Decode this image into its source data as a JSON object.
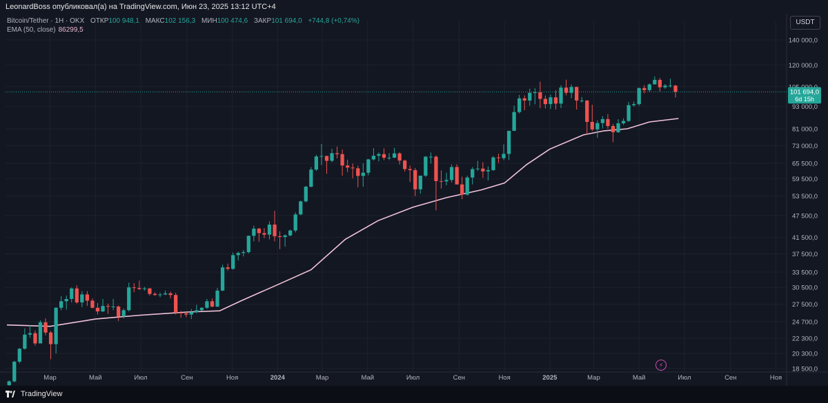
{
  "header": {
    "publish_line": "LeonardBoss опубликовал(а) на TradingView.com, Июн 23, 2025 13:12 UTC+4"
  },
  "legend": {
    "symbol": "Bitcoin/Tether · 1H · OKX",
    "open_label": "ОТКР",
    "open_value": "100 948,1",
    "high_label": "МАКС",
    "high_value": "102 156,3",
    "low_label": "МИН",
    "low_value": "100 474,6",
    "close_label": "ЗАКР",
    "close_value": "101 694,0",
    "change": "+744,8 (+0,74%)",
    "ema_label": "EMA (50, close)",
    "ema_value": "86299,5"
  },
  "currency_button": "USDT",
  "price_tag": {
    "price": "101 694,0",
    "countdown": "6d 15h"
  },
  "footer": {
    "brand": "TradingView"
  },
  "colors": {
    "up": "#26a69a",
    "down": "#ef5350",
    "ema": "#f2c4d9",
    "background": "#131722"
  },
  "chart_data": {
    "type": "candlestick",
    "title": "",
    "scale": "logarithmic",
    "last_price": 101694.0,
    "y_ticks": [
      {
        "value": 18500,
        "label": "18 500,0"
      },
      {
        "value": 20300,
        "label": "20 300,0"
      },
      {
        "value": 22300,
        "label": "22 300,0"
      },
      {
        "value": 24700,
        "label": "24 700,0"
      },
      {
        "value": 27500,
        "label": "27 500,0"
      },
      {
        "value": 30500,
        "label": "30 500,0"
      },
      {
        "value": 33500,
        "label": "33 500,0"
      },
      {
        "value": 37500,
        "label": "37 500,0"
      },
      {
        "value": 41500,
        "label": "41 500,0"
      },
      {
        "value": 47500,
        "label": "47 500,0"
      },
      {
        "value": 53500,
        "label": "53 500,0"
      },
      {
        "value": 59500,
        "label": "59 500,0"
      },
      {
        "value": 65500,
        "label": "65 500,0"
      },
      {
        "value": 73000,
        "label": "73 000,0"
      },
      {
        "value": 81000,
        "label": "81 000,0"
      },
      {
        "value": 93000,
        "label": "93 000,0"
      },
      {
        "value": 105000,
        "label": "105 000,0"
      },
      {
        "value": 120000,
        "label": "120 000,0"
      },
      {
        "value": 140000,
        "label": "140 000,0"
      }
    ],
    "x_ticks": [
      {
        "date": "2023-03-01",
        "label": "Мар"
      },
      {
        "date": "2023-05-01",
        "label": "Май"
      },
      {
        "date": "2023-07-01",
        "label": "Июл"
      },
      {
        "date": "2023-09-01",
        "label": "Сен"
      },
      {
        "date": "2023-11-01",
        "label": "Ноя"
      },
      {
        "date": "2024-01-01",
        "label": "2024"
      },
      {
        "date": "2024-03-01",
        "label": "Мар"
      },
      {
        "date": "2024-05-01",
        "label": "Май"
      },
      {
        "date": "2024-07-01",
        "label": "Июл"
      },
      {
        "date": "2024-09-01",
        "label": "Сен"
      },
      {
        "date": "2024-11-01",
        "label": "Ноя"
      },
      {
        "date": "2025-01-01",
        "label": "2025"
      },
      {
        "date": "2025-03-01",
        "label": "Мар"
      },
      {
        "date": "2025-05-01",
        "label": "Май"
      },
      {
        "date": "2025-07-01",
        "label": "Июл"
      },
      {
        "date": "2025-09-01",
        "label": "Сен"
      },
      {
        "date": "2025-11-01",
        "label": "Ноя"
      }
    ],
    "candle_start_date": "2023-01-02",
    "candle_interval_days": 7,
    "candles": [
      [
        16700,
        17200,
        16600,
        17100
      ],
      [
        17100,
        19400,
        17000,
        19300
      ],
      [
        19300,
        21000,
        19100,
        20900
      ],
      [
        20900,
        23700,
        20800,
        22800
      ],
      [
        22800,
        24200,
        22400,
        23000
      ],
      [
        23000,
        23400,
        21300,
        21600
      ],
      [
        21600,
        24900,
        21600,
        24600
      ],
      [
        24600,
        25200,
        22700,
        23100
      ],
      [
        23100,
        23300,
        19600,
        21500
      ],
      [
        21500,
        27000,
        20300,
        26900
      ],
      [
        26900,
        28900,
        26500,
        28000
      ],
      [
        28000,
        29000,
        26600,
        28400
      ],
      [
        28400,
        30500,
        27800,
        30300
      ],
      [
        30300,
        30900,
        27600,
        27800
      ],
      [
        27800,
        29800,
        27000,
        29200
      ],
      [
        29200,
        29800,
        27200,
        28100
      ],
      [
        28100,
        28500,
        26800,
        26900
      ],
      [
        26900,
        27700,
        25800,
        26300
      ],
      [
        26300,
        28400,
        26200,
        27200
      ],
      [
        27200,
        27600,
        25900,
        27100
      ],
      [
        27100,
        28400,
        26500,
        27100
      ],
      [
        27100,
        27300,
        24800,
        25500
      ],
      [
        25500,
        26800,
        25200,
        26500
      ],
      [
        26500,
        31400,
        26300,
        30500
      ],
      [
        30500,
        31300,
        29600,
        30400
      ],
      [
        30400,
        31800,
        30000,
        30200
      ],
      [
        30200,
        30600,
        29900,
        30300
      ],
      [
        30300,
        30400,
        29000,
        29300
      ],
      [
        29300,
        29600,
        29000,
        29100
      ],
      [
        29100,
        29500,
        28700,
        29200
      ],
      [
        29200,
        29900,
        29100,
        29400
      ],
      [
        29400,
        29700,
        28500,
        29100
      ],
      [
        29100,
        29500,
        25800,
        26100
      ],
      [
        26100,
        26400,
        25300,
        26000
      ],
      [
        26000,
        26200,
        25400,
        25800
      ],
      [
        25800,
        26700,
        25100,
        26200
      ],
      [
        26200,
        27400,
        26000,
        26500
      ],
      [
        26500,
        27000,
        26400,
        26900
      ],
      [
        26900,
        28400,
        26700,
        28000
      ],
      [
        28000,
        28500,
        27000,
        27100
      ],
      [
        27100,
        30400,
        27000,
        29900
      ],
      [
        29900,
        35100,
        29800,
        34500
      ],
      [
        34500,
        35300,
        33800,
        34200
      ],
      [
        34200,
        37800,
        34000,
        37200
      ],
      [
        37200,
        38000,
        36000,
        37700
      ],
      [
        37700,
        38400,
        36900,
        37900
      ],
      [
        37900,
        42000,
        37600,
        41900
      ],
      [
        41900,
        44600,
        40500,
        43800
      ],
      [
        43800,
        44000,
        40400,
        42600
      ],
      [
        42600,
        43900,
        41300,
        42200
      ],
      [
        42200,
        45800,
        41000,
        44900
      ],
      [
        44900,
        48900,
        40500,
        41800
      ],
      [
        41800,
        43100,
        38600,
        41600
      ],
      [
        41600,
        42300,
        39200,
        42000
      ],
      [
        42000,
        43500,
        41800,
        43300
      ],
      [
        43300,
        48400,
        42800,
        47800
      ],
      [
        47800,
        52100,
        47600,
        51800
      ],
      [
        51800,
        57000,
        51500,
        56700
      ],
      [
        56700,
        64000,
        56500,
        63000
      ],
      [
        63000,
        69000,
        62500,
        68300
      ],
      [
        68300,
        73800,
        64800,
        68500
      ],
      [
        68500,
        68700,
        61400,
        66500
      ],
      [
        66500,
        71600,
        66000,
        69700
      ],
      [
        69700,
        72600,
        67500,
        69300
      ],
      [
        69300,
        71300,
        60700,
        64600
      ],
      [
        64600,
        67000,
        62000,
        63800
      ],
      [
        63800,
        65400,
        59700,
        63500
      ],
      [
        63500,
        64500,
        56500,
        60600
      ],
      [
        60600,
        65500,
        56700,
        61800
      ],
      [
        61800,
        67300,
        60800,
        67100
      ],
      [
        67100,
        71900,
        66600,
        68600
      ],
      [
        68600,
        70000,
        66300,
        69300
      ],
      [
        69300,
        71800,
        66800,
        67800
      ],
      [
        67800,
        69700,
        66800,
        67800
      ],
      [
        67800,
        72000,
        67600,
        69600
      ],
      [
        69600,
        70100,
        65000,
        66600
      ],
      [
        66600,
        67000,
        62200,
        63200
      ],
      [
        63200,
        64600,
        58400,
        62800
      ],
      [
        62800,
        63600,
        53500,
        55800
      ],
      [
        55800,
        60700,
        54300,
        60700
      ],
      [
        60700,
        68500,
        60200,
        68200
      ],
      [
        68200,
        70000,
        65400,
        68200
      ],
      [
        68200,
        68800,
        49000,
        58700
      ],
      [
        58700,
        62700,
        56100,
        58600
      ],
      [
        58600,
        61800,
        57200,
        59100
      ],
      [
        59100,
        65000,
        58200,
        64000
      ],
      [
        64000,
        65100,
        57500,
        57500
      ],
      [
        57500,
        60300,
        52500,
        54000
      ],
      [
        54000,
        60700,
        53700,
        60000
      ],
      [
        60000,
        64000,
        57500,
        63200
      ],
      [
        63200,
        66500,
        62500,
        63400
      ],
      [
        63400,
        65900,
        59900,
        62300
      ],
      [
        62300,
        64200,
        58900,
        62800
      ],
      [
        62800,
        68500,
        62500,
        67900
      ],
      [
        67900,
        69500,
        65600,
        67600
      ],
      [
        67600,
        73600,
        66800,
        69400
      ],
      [
        69400,
        80000,
        66800,
        80000
      ],
      [
        80000,
        93400,
        79900,
        89800
      ],
      [
        89800,
        99800,
        89000,
        97700
      ],
      [
        97700,
        99500,
        90800,
        96400
      ],
      [
        96400,
        103700,
        93400,
        101100
      ],
      [
        101100,
        104000,
        94200,
        101400
      ],
      [
        101400,
        108300,
        92000,
        97400
      ],
      [
        97400,
        99400,
        91800,
        94300
      ],
      [
        94300,
        99900,
        91500,
        98300
      ],
      [
        98300,
        102700,
        91200,
        94600
      ],
      [
        94600,
        105900,
        92000,
        104400
      ],
      [
        104400,
        109600,
        99500,
        101100
      ],
      [
        101100,
        106400,
        97800,
        104800
      ],
      [
        104800,
        105000,
        91200,
        96400
      ],
      [
        96400,
        98500,
        95200,
        96400
      ],
      [
        96400,
        96600,
        78200,
        84500
      ],
      [
        84500,
        93900,
        79800,
        80700
      ],
      [
        80700,
        85300,
        76600,
        83900
      ],
      [
        83900,
        87500,
        81200,
        86000
      ],
      [
        86000,
        88700,
        81100,
        82400
      ],
      [
        82400,
        83500,
        74600,
        79300
      ],
      [
        79300,
        85900,
        79000,
        83800
      ],
      [
        83800,
        86400,
        83000,
        85000
      ],
      [
        85000,
        95600,
        84500,
        93700
      ],
      [
        93700,
        95800,
        92800,
        94300
      ],
      [
        94300,
        104400,
        93400,
        104100
      ],
      [
        104100,
        106000,
        100800,
        102800
      ],
      [
        102800,
        107100,
        101400,
        106500
      ],
      [
        106500,
        111900,
        106400,
        109500
      ],
      [
        109500,
        110700,
        102000,
        104600
      ],
      [
        104600,
        106700,
        103600,
        105700
      ],
      [
        105700,
        110300,
        104400,
        105700
      ],
      [
        105700,
        106100,
        98200,
        101700
      ]
    ],
    "ema": {
      "label": "EMA (50, close)",
      "points": [
        {
          "date": "2023-01-02",
          "value": 24200
        },
        {
          "date": "2023-03-01",
          "value": 24000
        },
        {
          "date": "2023-05-01",
          "value": 25100
        },
        {
          "date": "2023-07-01",
          "value": 25700
        },
        {
          "date": "2023-09-01",
          "value": 26200
        },
        {
          "date": "2023-10-15",
          "value": 26400
        },
        {
          "date": "2023-11-15",
          "value": 28200
        },
        {
          "date": "2024-01-01",
          "value": 31000
        },
        {
          "date": "2024-02-15",
          "value": 34000
        },
        {
          "date": "2024-04-01",
          "value": 41000
        },
        {
          "date": "2024-05-15",
          "value": 46000
        },
        {
          "date": "2024-07-01",
          "value": 50000
        },
        {
          "date": "2024-08-15",
          "value": 53000
        },
        {
          "date": "2024-10-01",
          "value": 55600
        },
        {
          "date": "2024-11-01",
          "value": 58000
        },
        {
          "date": "2024-12-01",
          "value": 65000
        },
        {
          "date": "2025-01-01",
          "value": 71500
        },
        {
          "date": "2025-02-15",
          "value": 78000
        },
        {
          "date": "2025-03-15",
          "value": 80000
        },
        {
          "date": "2025-04-15",
          "value": 81000
        },
        {
          "date": "2025-05-15",
          "value": 84500
        },
        {
          "date": "2025-06-23",
          "value": 86299.5
        }
      ]
    }
  }
}
